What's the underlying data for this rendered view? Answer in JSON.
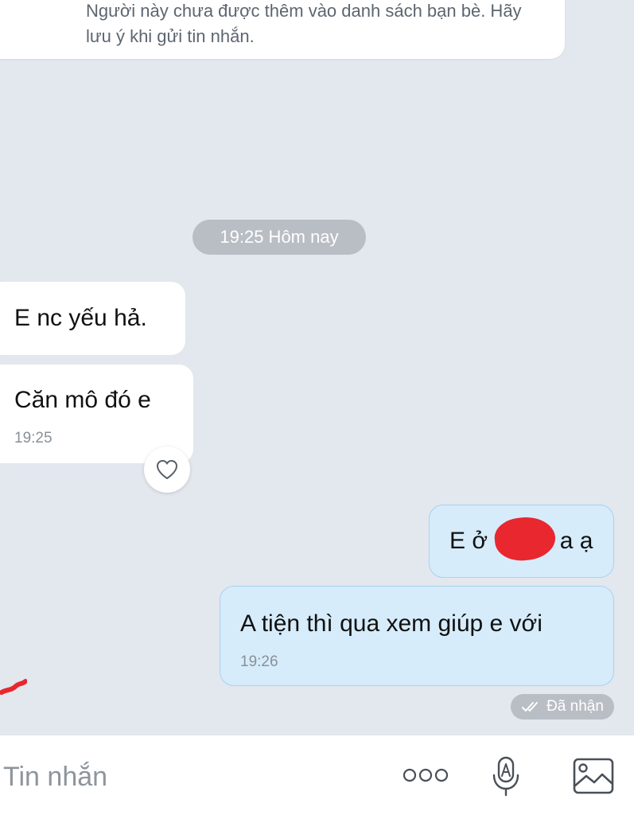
{
  "notice": {
    "text": "Người này chưa được thêm vào danh sách bạn bè. Hãy lưu ý khi gửi tin nhắn."
  },
  "timestamp_pill": "19:25 Hôm nay",
  "messages": [
    {
      "direction": "incoming",
      "text": "E nc yếu hả."
    },
    {
      "direction": "incoming",
      "text": "Căn mô đó e",
      "time": "19:25"
    },
    {
      "direction": "outgoing",
      "text_before": "E ở",
      "text_after": "a ạ"
    },
    {
      "direction": "outgoing",
      "text": "A tiện thì qua xem giúp e với",
      "time": "19:26"
    }
  ],
  "reaction_icon": "heart-icon",
  "status": {
    "icon": "double-check-icon",
    "label": "Đã nhận"
  },
  "composer": {
    "placeholder": "Tin nhắn",
    "icons": [
      "more-options-icon",
      "voice-to-text-icon",
      "image-picker-icon"
    ]
  },
  "colors": {
    "background": "#e3e7ee",
    "incoming_bubble": "#ffffff",
    "outgoing_bubble": "#d6ecfb",
    "outgoing_border": "#a9d2f0",
    "pill": "#b9bdc4"
  }
}
